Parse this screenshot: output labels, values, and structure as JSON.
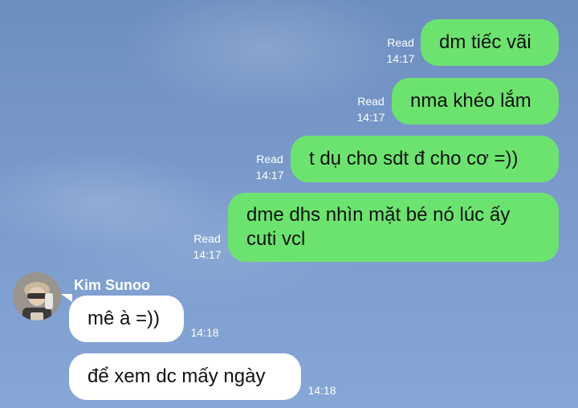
{
  "messages_out": [
    {
      "text": "dm tiếc vãi",
      "status": "Read",
      "time": "14:17"
    },
    {
      "text": "nma khéo lắm",
      "status": "Read",
      "time": "14:17"
    },
    {
      "text": "t dụ cho sdt đ cho cơ =))",
      "status": "Read",
      "time": "14:17"
    },
    {
      "text": "dme dhs nhìn mặt bé nó lúc ấy cuti vcl",
      "status": "Read",
      "time": "14:17"
    }
  ],
  "contact": {
    "name": "Kim Sunoo",
    "avatar_icon": "user-avatar-photo"
  },
  "messages_in": [
    {
      "text": "mê à =))",
      "time": "14:18"
    },
    {
      "text": "để xem dc mấy ngày",
      "time": "14:18"
    }
  ],
  "colors": {
    "outgoing_bubble": "#6de36f",
    "incoming_bubble": "#ffffff"
  }
}
